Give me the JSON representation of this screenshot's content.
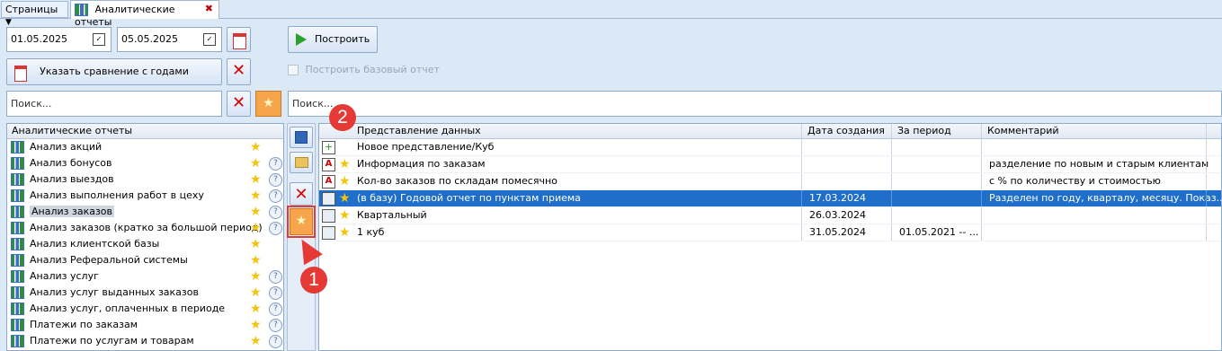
{
  "tabs": {
    "pages_label": "Страницы",
    "active_label": "Аналитические отчеты",
    "close_glyph": "✖"
  },
  "toolbar": {
    "date_from": "01.05.2025",
    "date_to": "05.05.2025",
    "build_label": "Построить",
    "compare_label": "Указать сравнение с годами",
    "base_report_label": "Построить базовый отчет",
    "search_placeholder_left": "Поиск...",
    "search_placeholder_right": "Поиск..."
  },
  "left_panel": {
    "header": "Аналитические отчеты",
    "items": [
      {
        "label": "Анализ акций",
        "help": false
      },
      {
        "label": "Анализ бонусов",
        "help": true
      },
      {
        "label": "Анализ выездов",
        "help": true
      },
      {
        "label": "Анализ выполнения работ в цеху",
        "help": true
      },
      {
        "label": "Анализ заказов",
        "help": true
      },
      {
        "label": "Анализ заказов (кратко за большой период)",
        "help": true
      },
      {
        "label": "Анализ клиентской базы",
        "help": false
      },
      {
        "label": "Анализ Реферальной системы",
        "help": false
      },
      {
        "label": "Анализ услуг",
        "help": true
      },
      {
        "label": "Анализ услуг выданных заказов",
        "help": true
      },
      {
        "label": "Анализ услуг, оплаченных в периоде",
        "help": true
      },
      {
        "label": "Платежи по заказам",
        "help": true
      },
      {
        "label": "Платежи по услугам и товарам",
        "help": true
      }
    ]
  },
  "table": {
    "columns": [
      "Представление данных",
      "Дата создания",
      "За период",
      "Комментарий"
    ],
    "rows": [
      {
        "name": "Новое представление/Куб",
        "created": "",
        "period": "",
        "comment": "",
        "icon": "new-view-icon",
        "star": false
      },
      {
        "name": "Информация по заказам",
        "created": "",
        "period": "",
        "comment": "разделение по новым и старым клиентам",
        "icon": "report-icon",
        "star": true
      },
      {
        "name": "Кол-во заказов по складам помесячно",
        "created": "",
        "period": "",
        "comment": "с % по количеству и стоимостью",
        "icon": "report-icon",
        "star": true
      },
      {
        "name": "(в базу) Годовой отчет по пунктам приема",
        "created": "17.03.2024",
        "period": "",
        "comment": "Разделен по году, кварталу, месяцу. Показ...",
        "icon": "cube-icon",
        "star": true
      },
      {
        "name": "Квартальный",
        "created": "26.03.2024",
        "period": "",
        "comment": "",
        "icon": "cube-icon",
        "star": true
      },
      {
        "name": "1 куб",
        "created": "31.05.2024",
        "period": "01.05.2021 -- ...",
        "comment": "",
        "icon": "cube-icon",
        "star": true
      }
    ]
  },
  "badges": {
    "one": "1",
    "two": "2"
  },
  "colors": {
    "accent": "#1f6fca",
    "badge": "#e53935",
    "star": "#f2c40c",
    "star_button": "#f7a54c"
  }
}
